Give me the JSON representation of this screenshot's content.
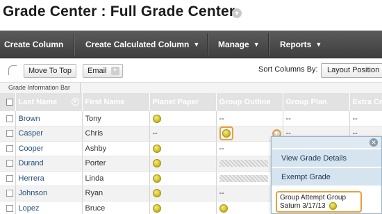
{
  "page": {
    "title": "Grade Center : Full Grade Center"
  },
  "menubar": {
    "items": [
      {
        "label": "Create Column",
        "has_caret": false
      },
      {
        "label": "Create Calculated Column",
        "has_caret": true
      },
      {
        "label": "Manage",
        "has_caret": true
      },
      {
        "label": "Reports",
        "has_caret": true
      }
    ]
  },
  "toolbar": {
    "move_to_top_label": "Move To Top",
    "email_label": "Email",
    "sort_by_label": "Sort Columns By:",
    "sort_by_value": "Layout Position"
  },
  "info_bar": {
    "label": "Grade Information Bar"
  },
  "grid": {
    "columns": [
      "Last Name",
      "First Name",
      "Planet Paper",
      "Group Outline",
      "Group Plan",
      "Extra Cre"
    ],
    "rows": [
      {
        "last": "Brown",
        "first": "Tony",
        "planet": "icon",
        "outline": "--",
        "plan": "--",
        "extra": "--"
      },
      {
        "last": "Casper",
        "first": "Chris",
        "planet": "--",
        "outline": "icon-highlight",
        "plan": "--",
        "extra": "--"
      },
      {
        "last": "Cooper",
        "first": "Ashby",
        "planet": "icon",
        "outline": "--",
        "plan": "",
        "extra": ""
      },
      {
        "last": "Durand",
        "first": "Porter",
        "planet": "icon",
        "outline": "hatch",
        "plan": "",
        "extra": ""
      },
      {
        "last": "Herrera",
        "first": "Linda",
        "planet": "icon",
        "outline": "hatch",
        "plan": "",
        "extra": ""
      },
      {
        "last": "Johnson",
        "first": "Ryan",
        "planet": "icon",
        "outline": "--",
        "plan": "",
        "extra": ""
      },
      {
        "last": "Lopez",
        "first": "Bruce",
        "planet": "icon",
        "outline": "icon",
        "plan": "",
        "extra": ""
      }
    ]
  },
  "context_menu": {
    "items": [
      "View Grade Details",
      "Exempt Grade"
    ],
    "attempt_line1": "Group Attempt Group",
    "attempt_line2": "Saturn 3/17/13"
  },
  "colors": {
    "menubar": "#4a4a4a",
    "header": "#e2e2e2",
    "link": "#29517a",
    "highlight": "#e8a03a",
    "popup_item": "#d6e4f0"
  },
  "icons": {
    "needs_grading": "yellow-exclamation-icon",
    "cell_menu": "chevron-down-icon",
    "close": "close-icon"
  }
}
